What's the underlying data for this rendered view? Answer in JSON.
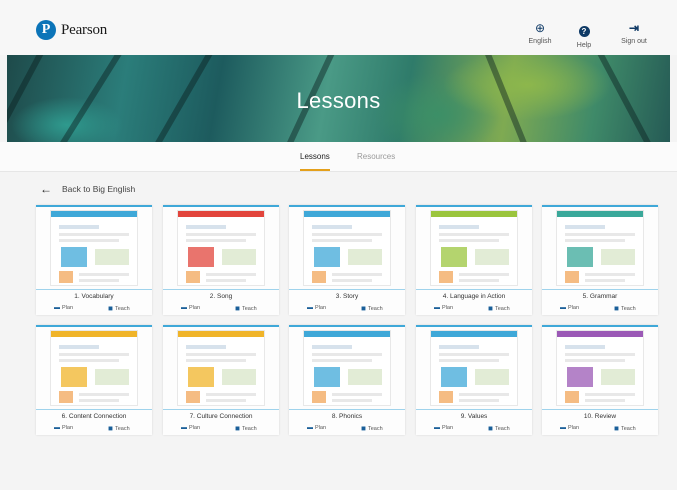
{
  "header": {
    "logo_text": "Pearson",
    "logo_letter": "P",
    "buttons": [
      {
        "label": "English",
        "icon": "globe-icon",
        "glyph": "⊕"
      },
      {
        "label": "Help",
        "icon": "help-icon",
        "glyph": "?"
      },
      {
        "label": "Sign out",
        "icon": "sign-out-icon",
        "glyph": "⇥"
      }
    ]
  },
  "banner": {
    "title": "Lessons"
  },
  "tabs": [
    {
      "label": "Lessons",
      "active": true
    },
    {
      "label": "Resources",
      "active": false
    }
  ],
  "back_link": {
    "label": "Back to Big English",
    "icon": "back-arrow-icon"
  },
  "actions": {
    "plan": "Plan",
    "teach": "Teach"
  },
  "lessons": [
    {
      "title": "1. Vocabulary",
      "accent": "#3fa8d8"
    },
    {
      "title": "2. Song",
      "accent": "#e2453c"
    },
    {
      "title": "3. Story",
      "accent": "#3fa8d8"
    },
    {
      "title": "4. Language in Action",
      "accent": "#9bc53d"
    },
    {
      "title": "5. Grammar",
      "accent": "#3aa89a"
    },
    {
      "title": "6. Content Connection",
      "accent": "#f0b429"
    },
    {
      "title": "7. Culture Connection",
      "accent": "#f0b429"
    },
    {
      "title": "8. Phonics",
      "accent": "#3fa8d8"
    },
    {
      "title": "9. Values",
      "accent": "#3fa8d8"
    },
    {
      "title": "10. Review",
      "accent": "#9b59b6"
    }
  ],
  "colors": {
    "brand": "#0b74b8",
    "tab_underline": "#e4a01b",
    "card_border": "#3fa8d8"
  }
}
